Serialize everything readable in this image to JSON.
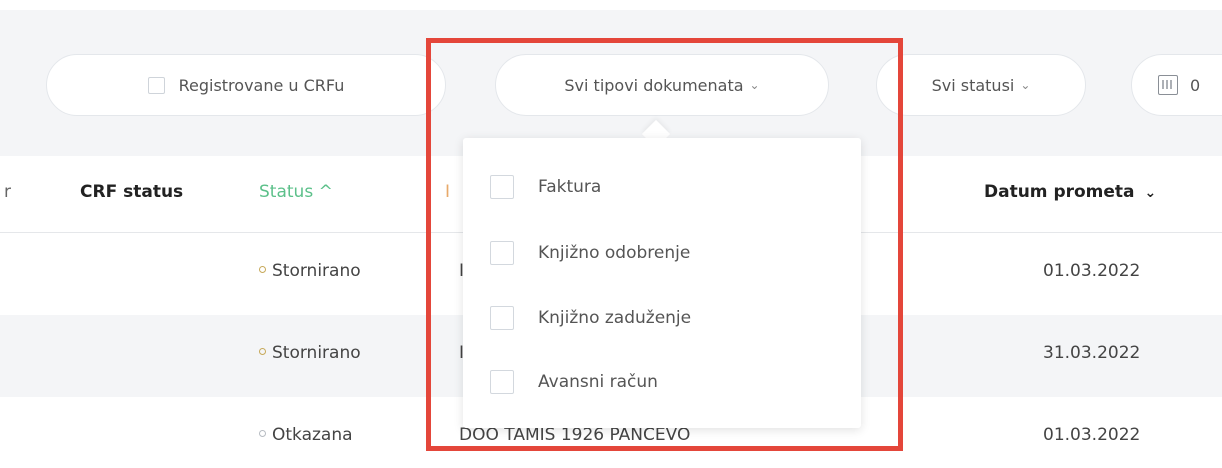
{
  "filters": {
    "crf_label": "Registrovane u CRFu",
    "doc_types_label": "Svi tipovi dokumenata",
    "statuses_label": "Svi statusi",
    "date_value": "0"
  },
  "table": {
    "headers": {
      "partial": "r",
      "crf_status": "CRF status",
      "status": "Status ^",
      "doc_partial": "I",
      "date": "Datum prometa"
    },
    "rows": [
      {
        "status": "Stornirano",
        "doc": "I",
        "date": "01.03.2022"
      },
      {
        "status": "Stornirano",
        "doc": "I",
        "date": "31.03.2022"
      },
      {
        "status": "Otkazana",
        "doc": "DOO TAMIS 1926 PANCEVO",
        "date": "01.03.2022"
      }
    ]
  },
  "dropdown": {
    "options": [
      "Faktura",
      "Knjižno odobrenje",
      "Knjižno zaduženje",
      "Avansni račun"
    ]
  },
  "colors": {
    "accent_green": "#5cc08a",
    "highlight": "#e4463a"
  }
}
